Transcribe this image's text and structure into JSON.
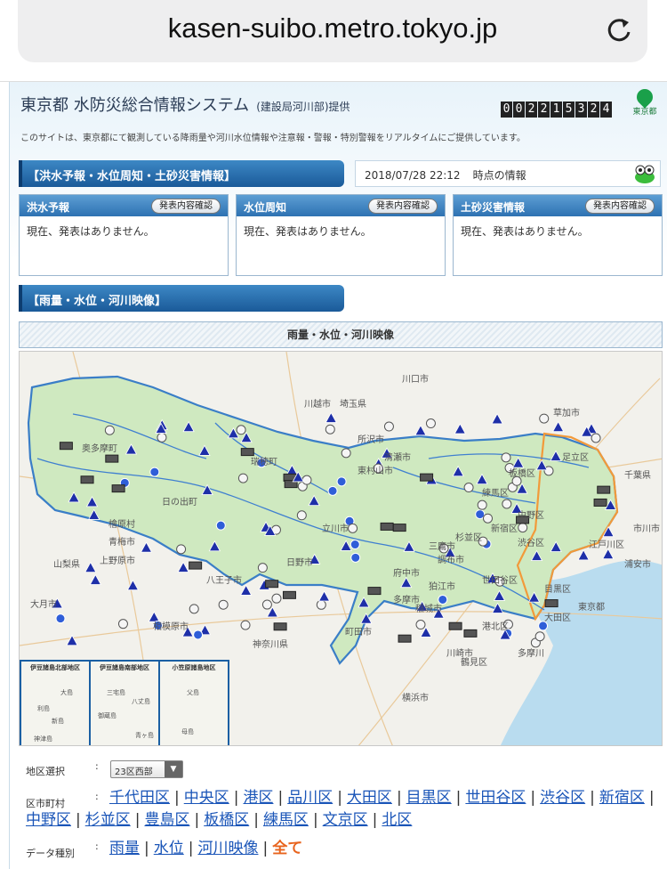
{
  "browser": {
    "url": "kasen-suibo.metro.tokyo.jp",
    "reload_icon": "reload-icon"
  },
  "header": {
    "title": "東京都 水防災総合情報システム",
    "provider": "(建設局河川部)提供",
    "counter": "002215324",
    "logo_text": "東京都",
    "description": "このサイトは、東京都にて観測している降雨量や河川水位情報や注意報・警報・特別警報をリアルタイムにご提供しています。"
  },
  "warning_section": {
    "title": "【洪水予報・水位周知・土砂災害情報】",
    "timestamp": "2018/07/28 22:12",
    "timestamp_suffix": "時点の情報",
    "panels": [
      {
        "title": "洪水予報",
        "button": "発表内容確認",
        "body": "現在、発表はありません。"
      },
      {
        "title": "水位周知",
        "button": "発表内容確認",
        "body": "現在、発表はありません。"
      },
      {
        "title": "土砂災害情報",
        "button": "発表内容確認",
        "body": "現在、発表はありません。"
      }
    ]
  },
  "map_section": {
    "title": "【雨量・水位・河川映像】",
    "map_header": "雨量・水位・河川映像",
    "place_labels": [
      "埼玉県",
      "山梨県",
      "神奈川県",
      "東京都",
      "千葉県",
      "青梅市",
      "八王子市",
      "町田市",
      "立川市",
      "府中市",
      "川崎市",
      "横浜市",
      "相模原市",
      "所沢市",
      "大月市",
      "調布市",
      "世田谷区",
      "練馬区",
      "江戸川区",
      "大田区",
      "港北区",
      "中野区",
      "奥多摩町",
      "檜原村",
      "日野市",
      "三鷹市",
      "川越市",
      "上野原市",
      "鶴見区",
      "多摩川",
      "浦安市",
      "市川市",
      "足立区",
      "板橋区",
      "渋谷区",
      "新宿区",
      "杉並区",
      "目黒区",
      "川口市",
      "草加市",
      "清瀬市",
      "東村山市",
      "多摩市",
      "稲城市",
      "狛江市",
      "日の出町",
      "瑞穂町"
    ],
    "insets": [
      "伊豆諸島北部地区",
      "伊豆諸島南部地区",
      "小笠原諸島地区"
    ],
    "inset_places": [
      "大島",
      "利島",
      "新島",
      "神津島",
      "三宅島",
      "御蔵島",
      "八丈島",
      "青ヶ島",
      "父島",
      "母島"
    ]
  },
  "filters": {
    "area_label": "地区選択",
    "area_value": "23区西部",
    "city_label": "区市町村",
    "cities": [
      "千代田区",
      "中央区",
      "港区",
      "品川区",
      "大田区",
      "目黒区",
      "世田谷区",
      "渋谷区",
      "新宿区",
      "中野区",
      "杉並区",
      "豊島区",
      "板橋区",
      "練馬区",
      "文京区",
      "北区"
    ],
    "type_label": "データ種別",
    "types": [
      "雨量",
      "水位",
      "河川映像"
    ],
    "type_all": "全て"
  },
  "colors": {
    "accent": "#1a5a99",
    "link": "#1a55b8",
    "highlight": "#e8641e",
    "map_land": "#cfe9c0"
  }
}
